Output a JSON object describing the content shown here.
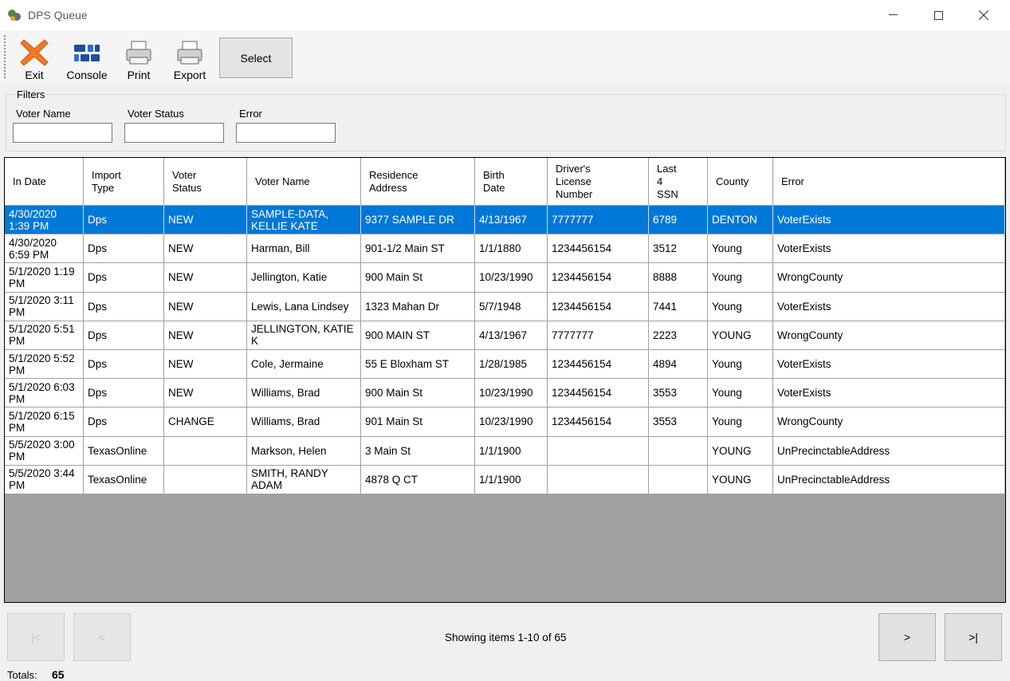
{
  "window": {
    "title": "DPS Queue",
    "controls": {
      "minimize": "—",
      "maximize": "☐",
      "close": "✕"
    }
  },
  "toolbar": {
    "exit": "Exit",
    "console": "Console",
    "print": "Print",
    "export": "Export",
    "select": "Select"
  },
  "filters": {
    "legend": "Filters",
    "voter_name": {
      "label": "Voter Name",
      "value": ""
    },
    "voter_status": {
      "label": "Voter Status",
      "value": ""
    },
    "error": {
      "label": "Error",
      "value": ""
    }
  },
  "grid": {
    "columns": [
      "In Date",
      "Import\nType",
      "Voter\nStatus",
      "Voter Name",
      "Residence\nAddress",
      "Birth\nDate",
      "Driver's\nLicense\nNumber",
      "Last\n4\nSSN",
      "County",
      "Error"
    ],
    "selected_row": 0,
    "rows": [
      [
        "4/30/2020\n1:39 PM",
        "Dps",
        "NEW",
        "SAMPLE-DATA,\nKELLIE KATE",
        "9377 SAMPLE DR",
        "4/13/1967",
        "7777777",
        "6789",
        "DENTON",
        "VoterExists"
      ],
      [
        "4/30/2020\n6:59 PM",
        "Dps",
        "NEW",
        "Harman, Bill",
        "901-1/2 Main ST",
        "1/1/1880",
        "1234456154",
        "3512",
        "Young",
        "VoterExists"
      ],
      [
        "5/1/2020 1:19\nPM",
        "Dps",
        "NEW",
        "Jellington, Katie",
        "900 Main St",
        "10/23/1990",
        "1234456154",
        "8888",
        "Young",
        "WrongCounty"
      ],
      [
        "5/1/2020 3:11\nPM",
        "Dps",
        "NEW",
        "Lewis, Lana Lindsey",
        "1323 Mahan Dr",
        "5/7/1948",
        "1234456154",
        "7441",
        "Young",
        "VoterExists"
      ],
      [
        "5/1/2020 5:51\nPM",
        "Dps",
        "NEW",
        "JELLINGTON, KATIE\nK",
        "900 MAIN ST",
        "4/13/1967",
        "7777777",
        "2223",
        "YOUNG",
        "WrongCounty"
      ],
      [
        "5/1/2020 5:52\nPM",
        "Dps",
        "NEW",
        "Cole, Jermaine",
        "55 E Bloxham ST",
        "1/28/1985",
        "1234456154",
        "4894",
        "Young",
        "VoterExists"
      ],
      [
        "5/1/2020 6:03\nPM",
        "Dps",
        "NEW",
        "Williams, Brad",
        "900 Main St",
        "10/23/1990",
        "1234456154",
        "3553",
        "Young",
        "VoterExists"
      ],
      [
        "5/1/2020 6:15\nPM",
        "Dps",
        "CHANGE",
        "Williams, Brad",
        "901 Main St",
        "10/23/1990",
        "1234456154",
        "3553",
        "Young",
        "WrongCounty"
      ],
      [
        "5/5/2020 3:00\nPM",
        "TexasOnline",
        "",
        "Markson, Helen",
        " 3 Main  St",
        "1/1/1900",
        "",
        "",
        "YOUNG\n ",
        "UnPrecinctableAddress"
      ],
      [
        "5/5/2020 3:44\nPM",
        "TexasOnline",
        "",
        "SMITH, RANDY\nADAM",
        " 4878 Q CT",
        "1/1/1900",
        "",
        "",
        "YOUNG\n ",
        "UnPrecinctableAddress"
      ]
    ]
  },
  "pager": {
    "first": "|<",
    "prev": "<",
    "next": ">",
    "last": ">|",
    "status": "Showing items 1-10 of 65"
  },
  "totals": {
    "label": "Totals:",
    "value": "65"
  },
  "colors": {
    "selection": "#0078d7",
    "grid_empty": "#a0a0a0",
    "exit_icon": "#f07a1f",
    "console_icon": "#1f4e9c"
  }
}
